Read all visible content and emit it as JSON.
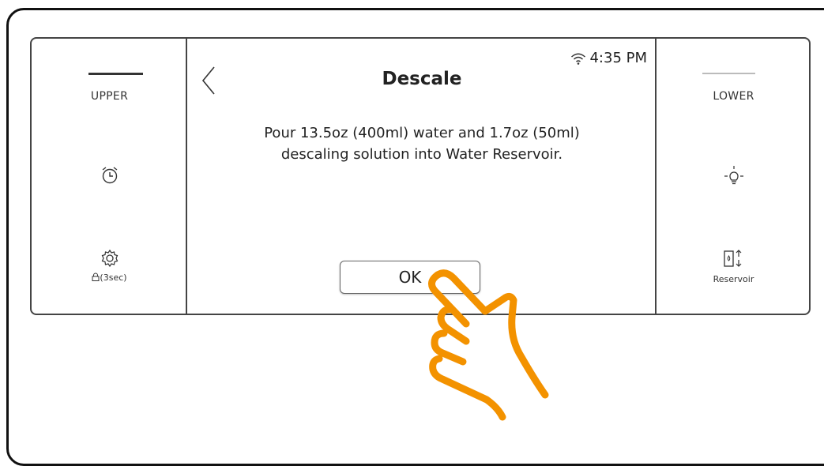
{
  "upper": {
    "label": "UPPER",
    "lock_label": "(3sec)"
  },
  "lower": {
    "label": "LOWER",
    "reservoir_label": "Reservoir"
  },
  "screen": {
    "time": "4:35 PM",
    "title": "Descale",
    "message_line1": "Pour 13.5oz (400ml) water and 1.7oz (50ml)",
    "message_line2": "descaling solution into Water Reservoir.",
    "ok_label": "OK"
  },
  "colors": {
    "accent": "#F39200",
    "frame": "#111111"
  },
  "icons": [
    "back-chevron-icon",
    "wifi-icon",
    "alarm-clock-icon",
    "gear-icon",
    "lock-icon",
    "light-bulb-icon",
    "reservoir-icon",
    "pointing-hand-icon"
  ]
}
